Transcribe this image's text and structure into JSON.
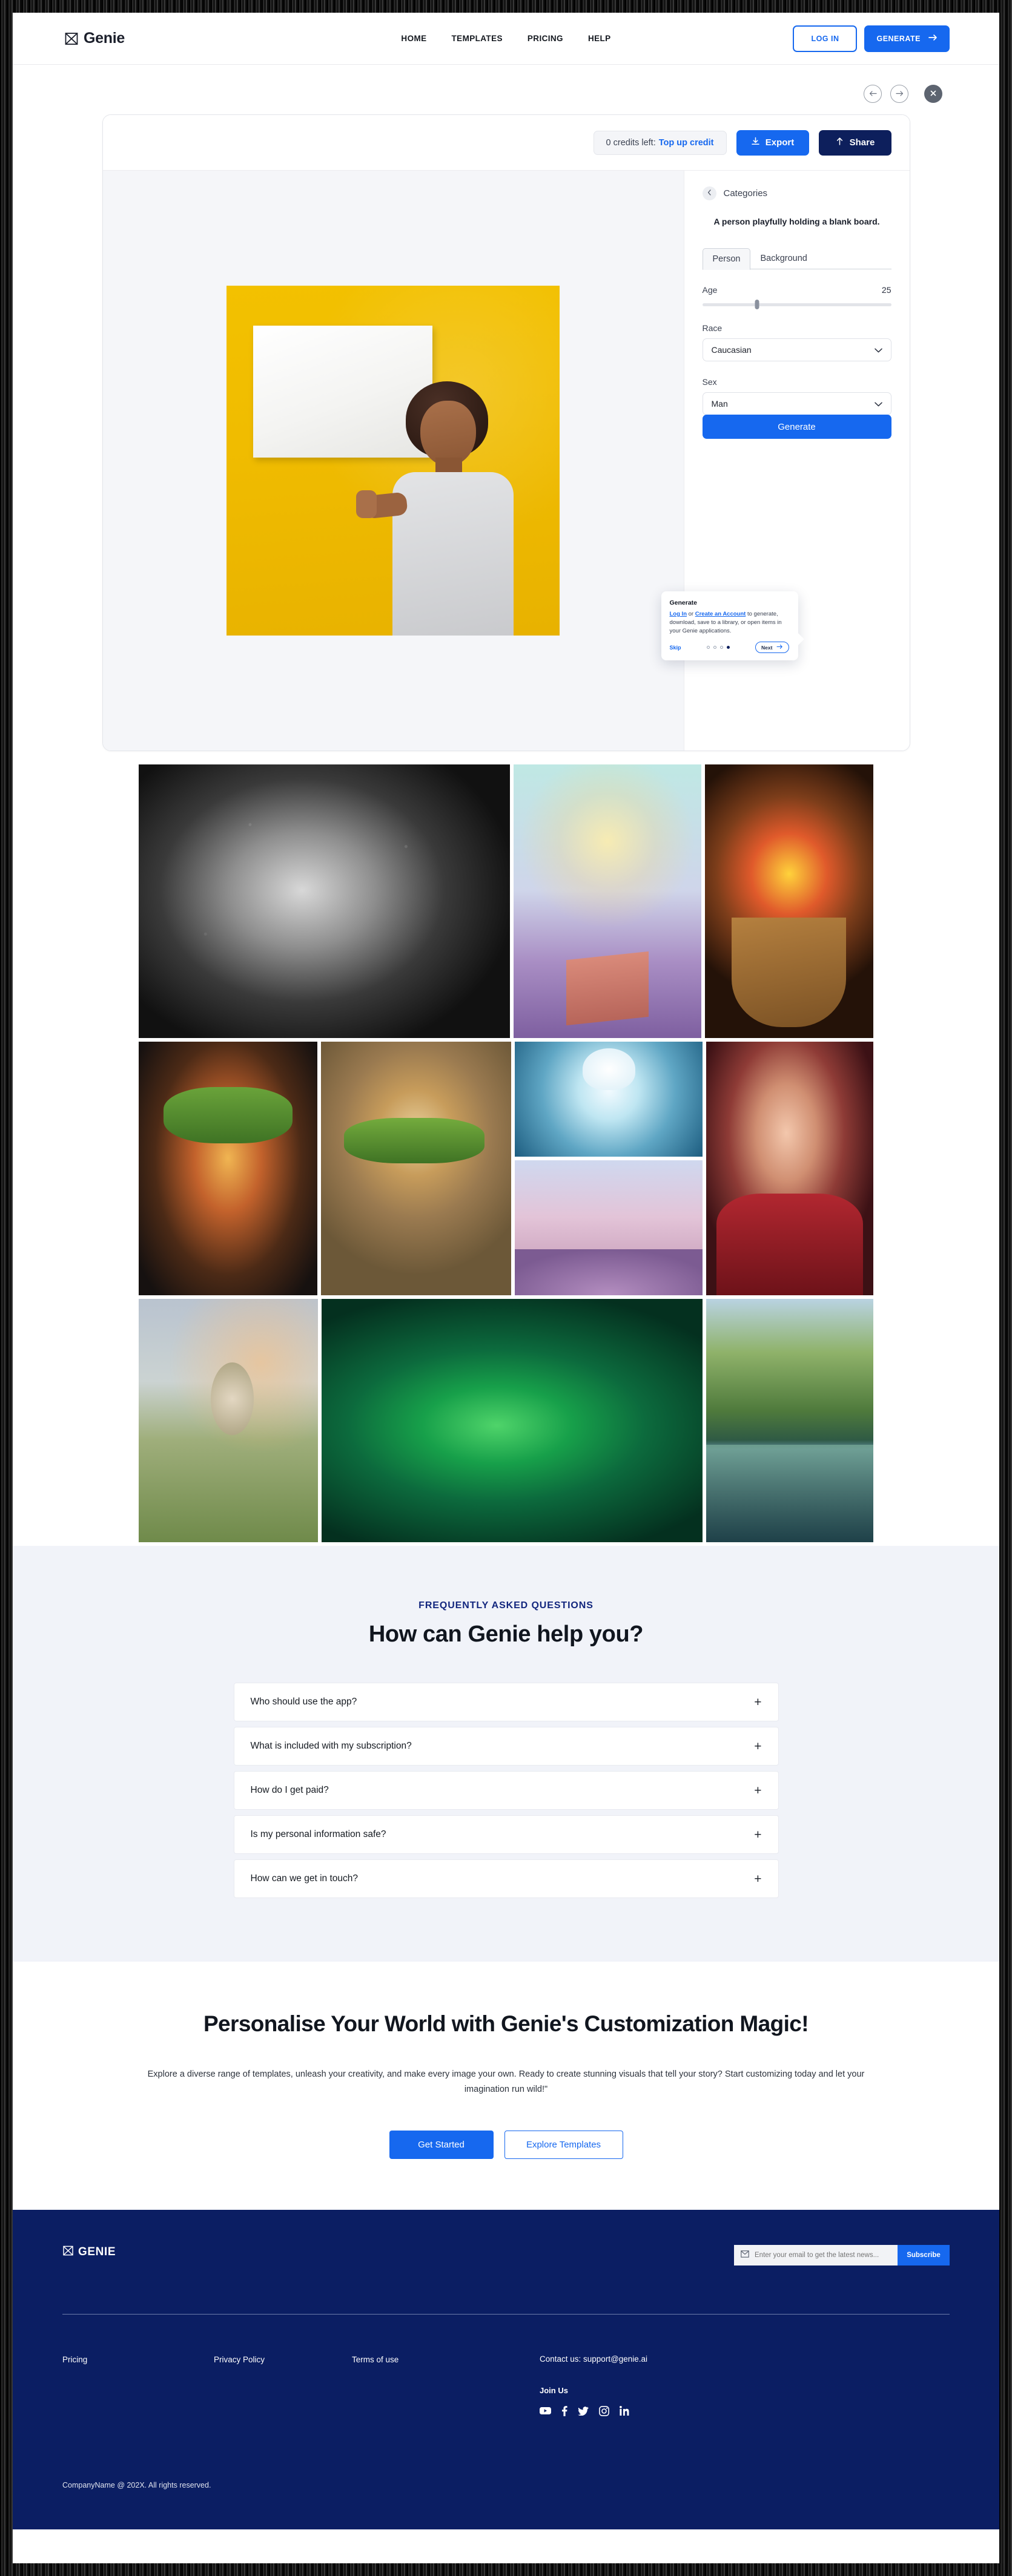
{
  "nav": {
    "brand": "Genie",
    "links": [
      "HOME",
      "TEMPLATES",
      "PRICING",
      "HELP"
    ],
    "login_label": "LOG IN",
    "generate_label": "GENERATE"
  },
  "editor": {
    "credits_text": "0 credits left:",
    "credits_link": "Top up credit",
    "export_label": "Export",
    "share_label": "Share",
    "categories_label": "Categories",
    "prompt": "A person playfully holding a blank board.",
    "tabs": [
      {
        "label": "Person",
        "active": true
      },
      {
        "label": "Background",
        "active": false
      }
    ],
    "age": {
      "label": "Age",
      "value": "25"
    },
    "race": {
      "label": "Race",
      "value": "Caucasian"
    },
    "sex": {
      "label": "Sex",
      "value": "Man"
    },
    "generate_label": "Generate"
  },
  "tour": {
    "title": "Generate",
    "body_link1": "Log In",
    "body_mid": " or ",
    "body_link2": "Create an Account",
    "body_rest": " to generate, download, save to a library, or open items in your Genie applications.",
    "skip_label": "Skip",
    "next_label": "Next",
    "dots_total": 4,
    "dot_active_index": 3
  },
  "gallery": {
    "row1": [
      {
        "name": "bw-portrait",
        "alt": "Black and white portrait of a woman with water droplets"
      },
      {
        "name": "magic-boy",
        "alt": "Boy swinging a glowing bat on a pedestal"
      },
      {
        "name": "fruit-basket",
        "alt": "Basket overflowing with colorful fruits"
      }
    ],
    "row2": [
      {
        "name": "tall-burger",
        "alt": "Tall stacked burger on dark background"
      },
      {
        "name": "flying-burger",
        "alt": "Burger with flying ingredients"
      },
      {
        "name": "blue-bunny",
        "alt": "Fluffy white bunny in magical underwater scene"
      },
      {
        "name": "dream-hill",
        "alt": "Person meditating on a hill with pink sky"
      },
      {
        "name": "red-woman",
        "alt": "Portrait of a woman in red"
      }
    ],
    "row3": [
      {
        "name": "lone-tree",
        "alt": "Tree in a field with bokeh lights"
      },
      {
        "name": "green-swamp",
        "alt": "Vivid green swamp landscape"
      },
      {
        "name": "forest-lake",
        "alt": "Lake surrounded by summer forest"
      }
    ]
  },
  "faq": {
    "kicker": "FREQUENTLY ASKED QUESTIONS",
    "title": "How can Genie help you?",
    "items": [
      "Who should use the app?",
      "What is included with my subscription?",
      "How do I get paid?",
      "Is my personal information safe?",
      "How can we get in touch?"
    ],
    "expand_glyph": "+"
  },
  "cta": {
    "title": "Personalise Your World with Genie's Customization Magic!",
    "body": "Explore a diverse range of templates, unleash your creativity, and make every image your own. Ready to create stunning visuals that tell your story? Start customizing today and let your imagination run wild!\"",
    "primary": "Get Started",
    "secondary": "Explore Templates"
  },
  "footer": {
    "brand": "GENIE",
    "email_placeholder": "Enter your email to get the latest news...",
    "subscribe_label": "Subscribe",
    "links": [
      "Pricing",
      "Privacy Policy",
      "Terms of use"
    ],
    "contact": "Contact us: support@genie.ai",
    "join_label": "Join Us",
    "social": [
      "youtube-icon",
      "facebook-icon",
      "twitter-icon",
      "instagram-icon",
      "linkedin-icon"
    ],
    "copyright": "CompanyName @ 202X. All rights reserved."
  },
  "colors": {
    "accent": "#1668ef",
    "navy": "#0b1e63",
    "share": "#0d1f5c",
    "faq_bg": "#f1f3f9"
  }
}
